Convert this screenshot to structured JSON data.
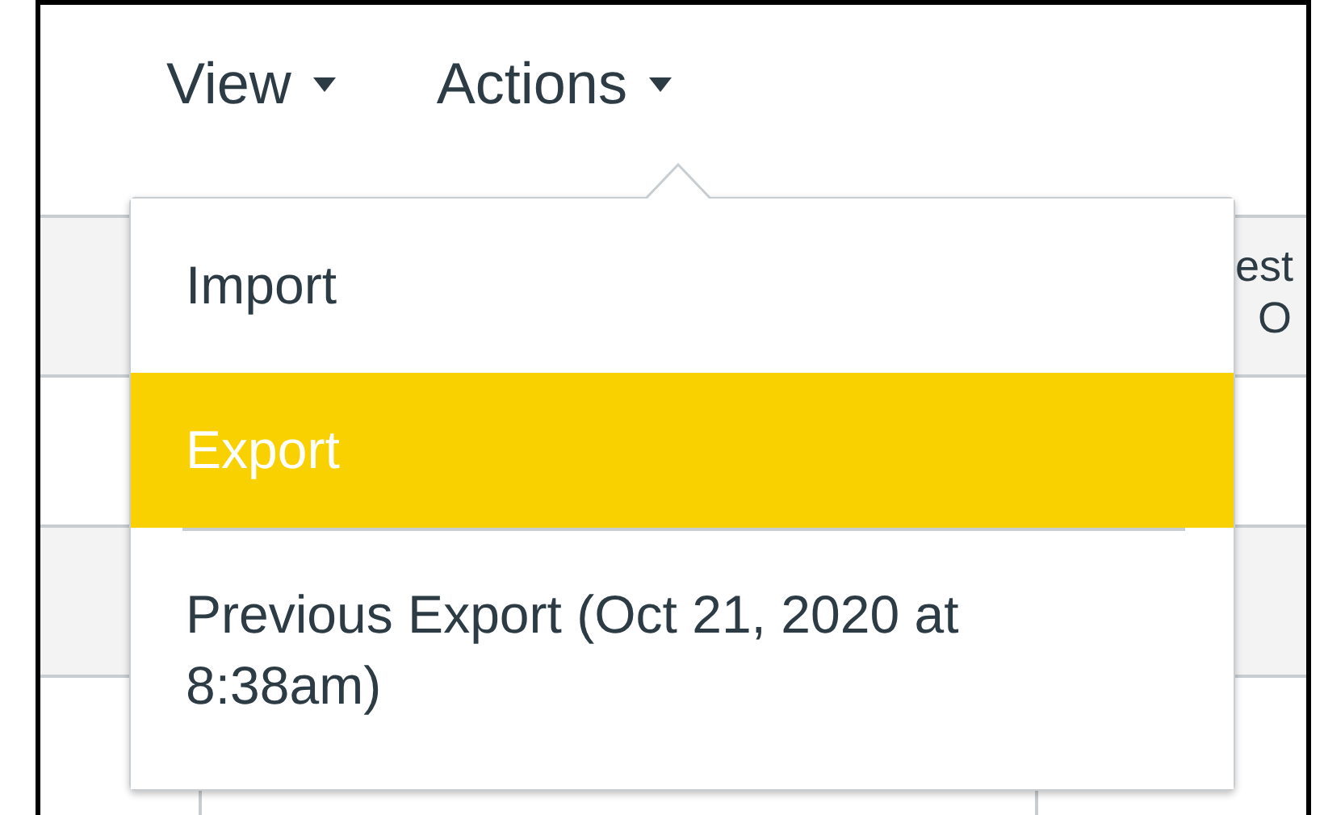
{
  "nav": [
    {
      "label": "View"
    },
    {
      "label": "Actions"
    }
  ],
  "table": {
    "header_fragment": [
      "est",
      "O"
    ]
  },
  "menu": {
    "items": [
      {
        "label": "Import",
        "selected": false
      },
      {
        "label": "Export",
        "selected": true
      },
      {
        "label": "Previous Export (Oct 21, 2020 at 8:38am)",
        "selected": false
      }
    ]
  }
}
